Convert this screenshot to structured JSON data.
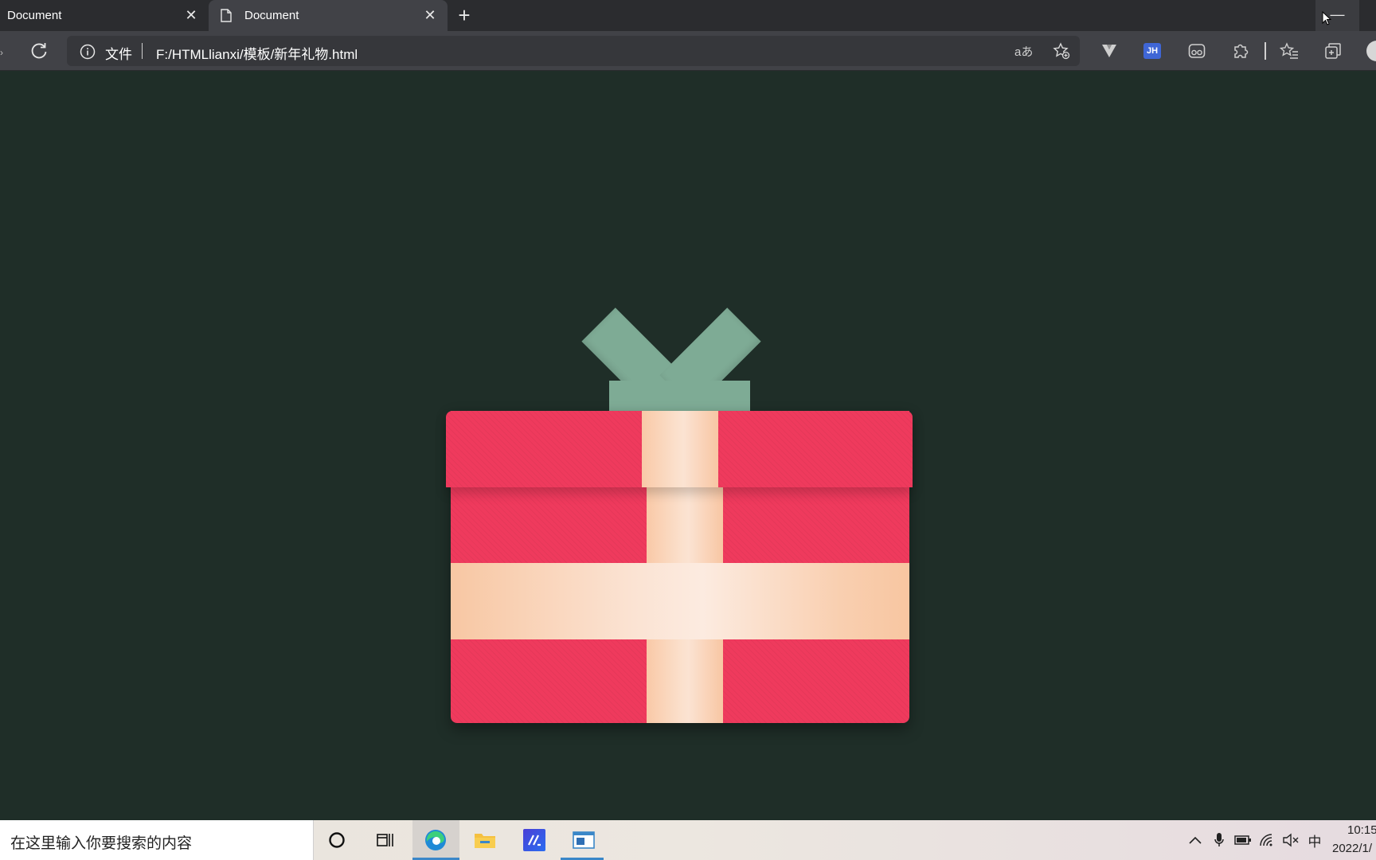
{
  "browser": {
    "tabs": [
      {
        "title": "Document",
        "active": false
      },
      {
        "title": "Document",
        "active": true
      }
    ],
    "address": {
      "scheme_label": "文件",
      "url": "F:/HTMLlianxi/模板/新年礼物.html",
      "read_aloud_label": "aあ"
    },
    "extensions": [
      "vue-devtools-icon",
      "jh-extension-icon",
      "reading-glasses-icon",
      "extensions-puzzle-icon"
    ],
    "extension_labels": {
      "jh": "JH"
    },
    "window": {
      "minimize_label": "—"
    }
  },
  "page": {
    "background_color": "#1f2e28",
    "gift": {
      "box_color": "#ef3a5d",
      "ribbon_color": "#fbe0cc",
      "bow_color": "#7eab95"
    }
  },
  "taskbar": {
    "search_placeholder": "在这里输入你要搜索的内容",
    "apps": [
      "cortana-icon",
      "task-view-icon",
      "edge-browser-icon",
      "file-explorer-icon",
      "visual-studio-icon",
      "app-window-icon"
    ],
    "tray": {
      "input_method": "中"
    },
    "clock": {
      "time": "10:15",
      "date": "2022/1/"
    }
  }
}
